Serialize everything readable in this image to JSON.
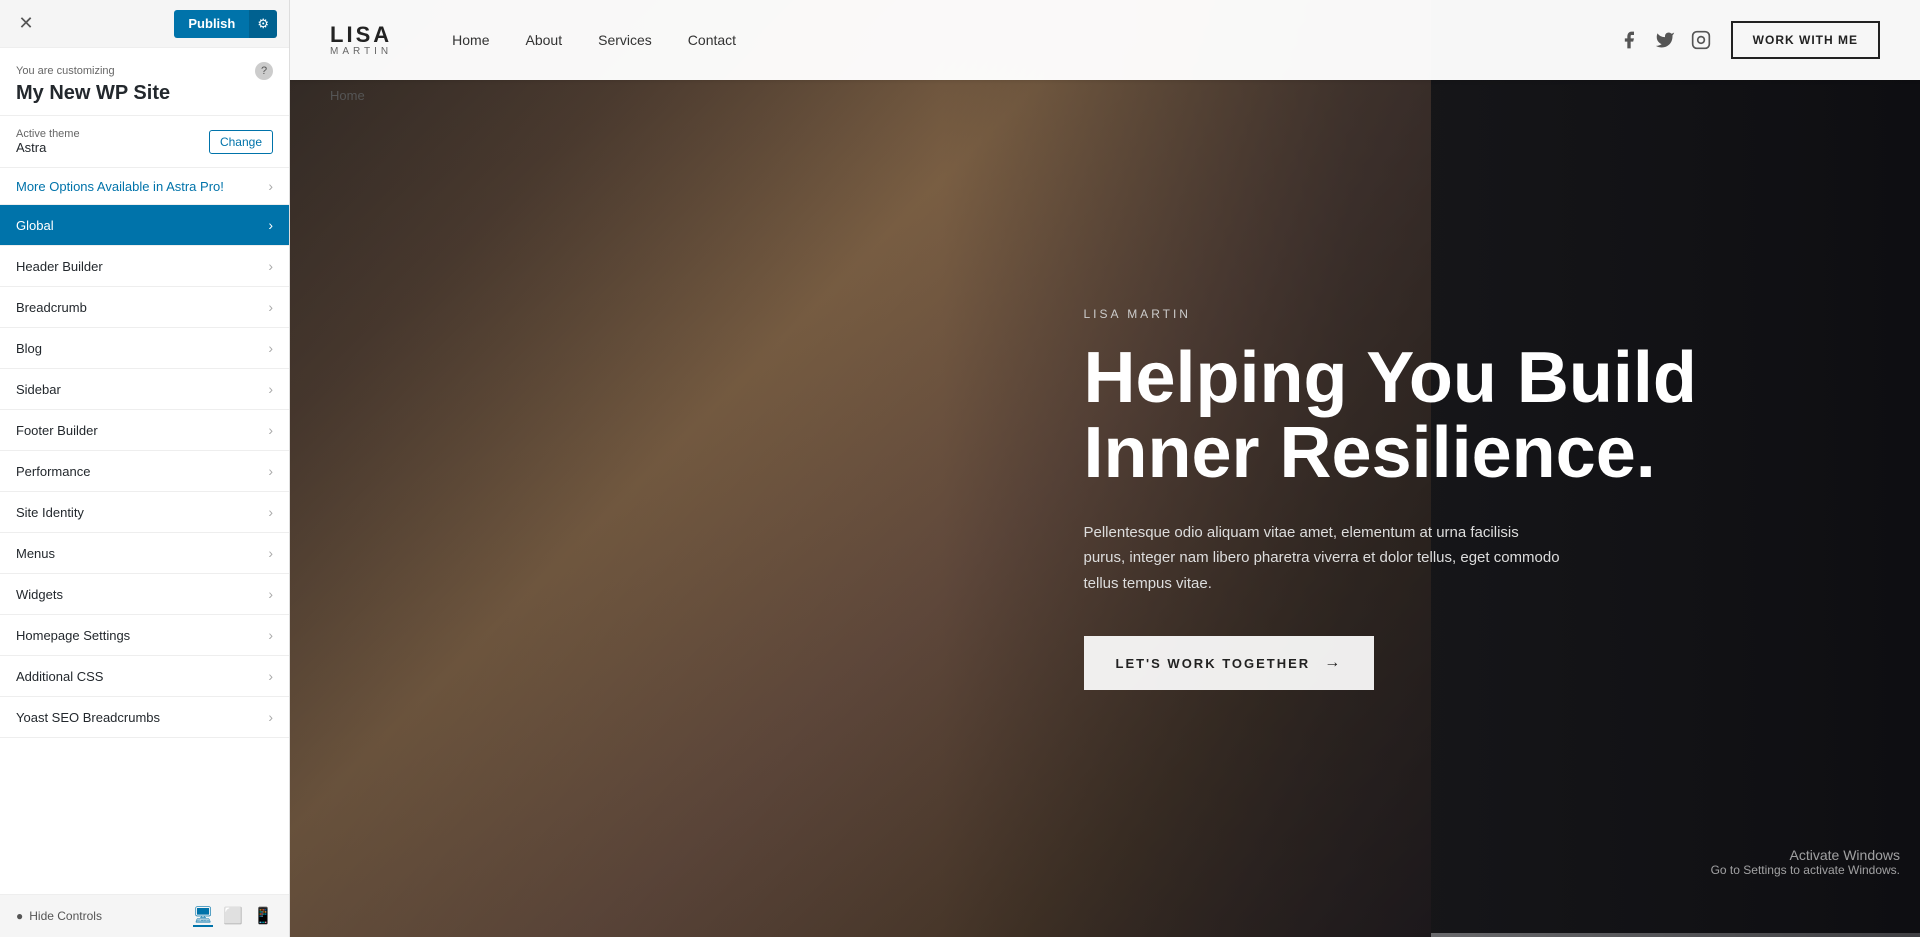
{
  "leftPanel": {
    "closeButton": "✕",
    "publish": {
      "label": "Publish",
      "gearIcon": "⚙"
    },
    "customizing": {
      "label": "You are customizing",
      "siteTitle": "My New WP Site"
    },
    "theme": {
      "label": "Active theme",
      "name": "Astra",
      "changeBtn": "Change"
    },
    "astraPro": {
      "label": "More Options Available in Astra Pro!",
      "chevron": "›"
    },
    "menuItems": [
      {
        "id": "global",
        "label": "Global",
        "active": true
      },
      {
        "id": "header-builder",
        "label": "Header Builder",
        "active": false
      },
      {
        "id": "breadcrumb",
        "label": "Breadcrumb",
        "active": false
      },
      {
        "id": "blog",
        "label": "Blog",
        "active": false
      },
      {
        "id": "sidebar",
        "label": "Sidebar",
        "active": false
      },
      {
        "id": "footer-builder",
        "label": "Footer Builder",
        "active": false
      },
      {
        "id": "performance",
        "label": "Performance",
        "active": false
      },
      {
        "id": "site-identity",
        "label": "Site Identity",
        "active": false
      },
      {
        "id": "menus",
        "label": "Menus",
        "active": false
      },
      {
        "id": "widgets",
        "label": "Widgets",
        "active": false
      },
      {
        "id": "homepage-settings",
        "label": "Homepage Settings",
        "active": false
      },
      {
        "id": "additional-css",
        "label": "Additional CSS",
        "active": false
      },
      {
        "id": "yoast-seo",
        "label": "Yoast SEO Breadcrumbs",
        "active": false
      }
    ],
    "bottomBar": {
      "hideControls": "Hide Controls",
      "eyeIcon": "👁",
      "devices": [
        "🖥",
        "📱",
        "📱"
      ]
    }
  },
  "sitePreview": {
    "nav": {
      "logoName": "LISA",
      "logoSub": "MARTIN",
      "links": [
        {
          "label": "Home"
        },
        {
          "label": "About"
        },
        {
          "label": "Services"
        },
        {
          "label": "Contact"
        }
      ],
      "workWithMeBtn": "WORK WITH ME"
    },
    "breadcrumb": "Home",
    "hero": {
      "tag": "LISA MARTIN",
      "headline": "Helping You Build\nInner Resilience.",
      "headlineLine1": "Helping You Build",
      "headlineLine2": "Inner Resilience.",
      "subtext": "Pellentesque odio aliquam vitae amet, elementum at urna facilisis purus, integer nam libero pharetra viverra et dolor tellus, eget commodo tellus tempus vitae.",
      "ctaBtn": "LET'S WORK TOGETHER",
      "ctaArrow": "→"
    },
    "activateWindows": {
      "line1": "Activate Windows",
      "line2": "Go to Settings to activate Windows."
    }
  }
}
